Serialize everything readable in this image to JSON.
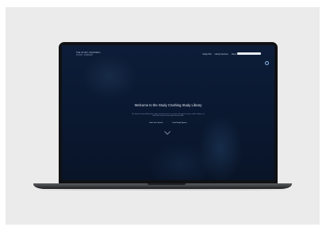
{
  "site": {
    "logo_line1": "THE STUDY CRUSHING",
    "logo_line2": "STUDY LIBRARY",
    "nav": [
      "Study Hub",
      "Library Services",
      "About"
    ],
    "search_placeholder": ""
  },
  "hero": {
    "title": "Welcome to the Study Crushing Study Library",
    "text": "The Study Crushing Study Library helps you find resources, services and support for your studies. Explore our collections and learn more about what we offer.",
    "button_primary": "Start Your Search",
    "button_secondary": "Find Study Spaces"
  },
  "colors": {
    "screen_background": "#0b1a33",
    "laptop_body": "#101114",
    "backdrop": "#ebebeb"
  },
  "icons": {
    "settings": "gear-icon",
    "scroll": "chevron-down-icon"
  }
}
